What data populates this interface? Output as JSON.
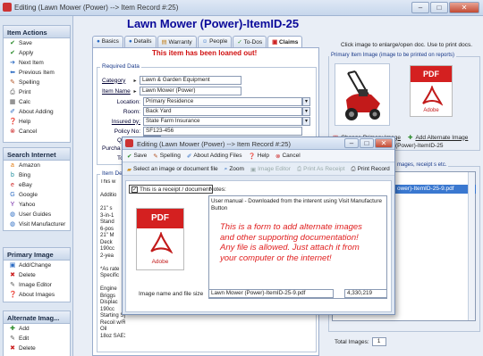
{
  "window": {
    "title": "Editing  (Lawn Mower (Power) --> Item Record #:25)",
    "min": "–",
    "max": "□",
    "close": "✕"
  },
  "sidebar": {
    "item_actions": {
      "title": "Item Actions",
      "items": [
        "Save",
        "Apply",
        "Next Item",
        "Previous Item",
        "Spelling",
        "Print",
        "Calc",
        "About Adding",
        "Help",
        "Cancel"
      ]
    },
    "search_internet": {
      "title": "Search Internet",
      "items": [
        "Amazon",
        "Bing",
        "eBay",
        "Google",
        "Yahoo",
        "User Guides",
        "Visit Manufacturer"
      ]
    },
    "primary_image": {
      "title": "Primary Image",
      "items": [
        "Add/Change",
        "Delete",
        "Image Editor",
        "About Images"
      ]
    },
    "alternate_images": {
      "title": "Alternate Imag...",
      "items": [
        "Add",
        "Edit",
        "Delete"
      ]
    }
  },
  "header": {
    "title": "Lawn Mower (Power)-ItemID-25"
  },
  "tabs": [
    "Basics",
    "Details",
    "Warranty",
    "People",
    "To-Dos",
    "Claims"
  ],
  "loaned_notice": "This item has been loaned out!",
  "required_data": {
    "group_title": "Required Data",
    "category": {
      "label": "Category",
      "value": "Lawn & Garden Equipment"
    },
    "item_name": {
      "label": "Item Name",
      "value": "Lawn Mower (Power)"
    },
    "location": {
      "label": "Location:",
      "value": "Primary Residence"
    },
    "room": {
      "label": "Room:",
      "value": "Back Yard"
    },
    "insured_by": {
      "label": "Insured by:",
      "value": "State Farm Insurance"
    },
    "policy_no": {
      "label": "Policy No:",
      "value": "SF123-456"
    },
    "quantity": {
      "label": "Quantity:",
      "value": "1"
    },
    "purchase_label": "Purcha",
    "to_label": "To"
  },
  "item_description": {
    "group_title": "Item Des",
    "lines": [
      "This w",
      "",
      "Additio",
      "",
      "21\" s",
      "3-in-1",
      "Stand",
      "6-pos",
      "21\" M",
      "Deck",
      "190cc",
      "2-yea",
      "",
      "*As rate",
      "Specific",
      "",
      "Engine",
      "Briggs",
      "Displac",
      "190cc",
      "Starting System",
      "Recoil w/ReadyStart",
      "Oil",
      "18oz SAE30 (included)"
    ]
  },
  "right": {
    "hint": "Click image to enlarge/open doc. Use to print docs.",
    "primary_group_title": "Primary Item Image (image to be printed on reports)",
    "change_primary": "Change Primary Image",
    "add_alternate": "Add Alternate Image",
    "pdf_caption": "(Power)-ItemID-25",
    "alt_group_title": "mages, receipt s etc.",
    "alt_list_item": "ower)-ItemID-25-9.pdf",
    "total_images_label": "Total Images:",
    "total_images_value": "1"
  },
  "dialog": {
    "title": "Editing  (Lawn Mower (Power) --> Item Record #:25)",
    "toolbar": [
      "Save",
      "Spelling",
      "About Adding Files",
      "Help",
      "Cancel"
    ],
    "toolbar2": [
      "Select an image or document file",
      "Zoom",
      "Image Editor",
      "Print As Receipt",
      "Print Record"
    ],
    "receipt_checkbox": "This is a receipt / document",
    "notes_label": "Notes:",
    "notes_text": "User manual - Downloaded from the interent using Visit Manufacture Button",
    "annotation": "This is a form to add alternate images and other supporting documentation! Any file is allowed. Just attach it from your computer or the internet!",
    "filename_label": "Image name and file size",
    "filename": "Lawn Mower (Power)-ItemID-25-9.pdf",
    "filesize": "4,330,219",
    "pdf_badge": "PDF",
    "adobe_text": "Adobe"
  },
  "colors": {
    "heading": "#0a0a9a",
    "loaned": "#d01010",
    "annotation": "#e02020",
    "pdf_red": "#d42020"
  }
}
